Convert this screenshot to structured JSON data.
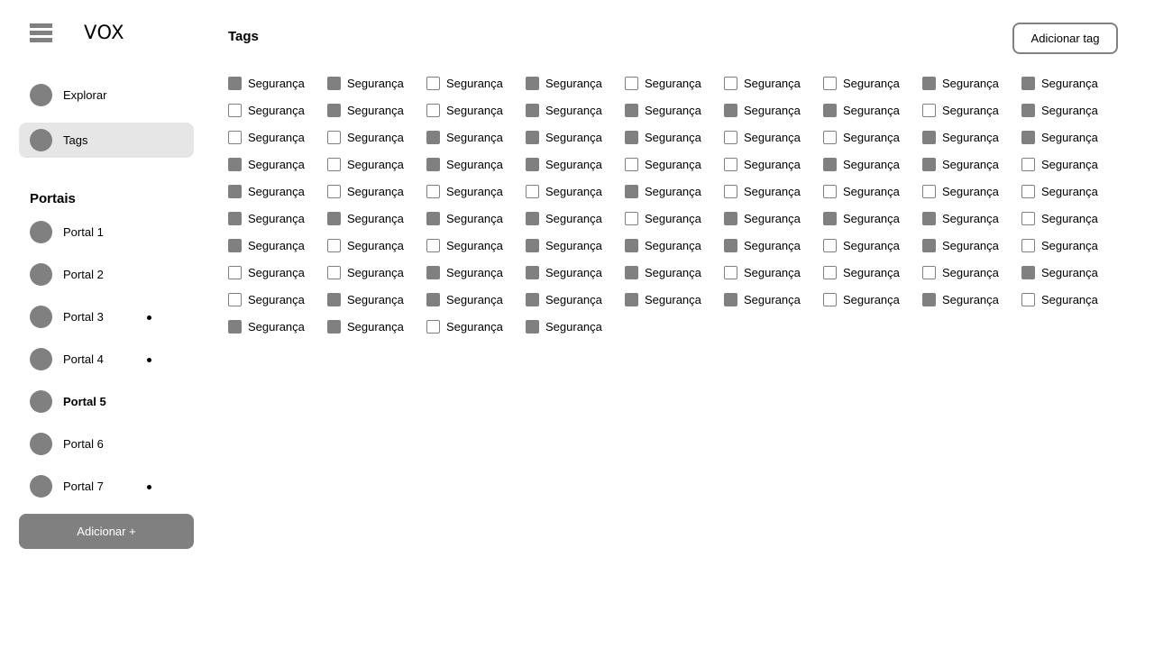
{
  "app": {
    "logo": "VOX"
  },
  "sidebar": {
    "nav": [
      {
        "label": "Explorar",
        "active": false
      },
      {
        "label": "Tags",
        "active": true
      }
    ],
    "portals_title": "Portais",
    "portals": [
      {
        "label": "Portal 1",
        "dot": false,
        "bold": false
      },
      {
        "label": "Portal 2",
        "dot": false,
        "bold": false
      },
      {
        "label": "Portal 3",
        "dot": true,
        "bold": false
      },
      {
        "label": "Portal 4",
        "dot": true,
        "bold": false
      },
      {
        "label": "Portal 5",
        "dot": false,
        "bold": true
      },
      {
        "label": "Portal 6",
        "dot": false,
        "bold": false
      },
      {
        "label": "Portal 7",
        "dot": true,
        "bold": false
      }
    ],
    "add_button": "Adicionar +"
  },
  "main": {
    "title": "Tags",
    "add_tag_button": "Adicionar tag",
    "tags": [
      {
        "label": "Segurança",
        "checked": true
      },
      {
        "label": "Segurança",
        "checked": true
      },
      {
        "label": "Segurança",
        "checked": false
      },
      {
        "label": "Segurança",
        "checked": true
      },
      {
        "label": "Segurança",
        "checked": false
      },
      {
        "label": "Segurança",
        "checked": false
      },
      {
        "label": "Segurança",
        "checked": false
      },
      {
        "label": "Segurança",
        "checked": true
      },
      {
        "label": "Segurança",
        "checked": true
      },
      {
        "label": "Segurança",
        "checked": false
      },
      {
        "label": "Segurança",
        "checked": true
      },
      {
        "label": "Segurança",
        "checked": false
      },
      {
        "label": "Segurança",
        "checked": true
      },
      {
        "label": "Segurança",
        "checked": true
      },
      {
        "label": "Segurança",
        "checked": true
      },
      {
        "label": "Segurança",
        "checked": true
      },
      {
        "label": "Segurança",
        "checked": false
      },
      {
        "label": "Segurança",
        "checked": true
      },
      {
        "label": "Segurança",
        "checked": false
      },
      {
        "label": "Segurança",
        "checked": false
      },
      {
        "label": "Segurança",
        "checked": true
      },
      {
        "label": "Segurança",
        "checked": true
      },
      {
        "label": "Segurança",
        "checked": true
      },
      {
        "label": "Segurança",
        "checked": false
      },
      {
        "label": "Segurança",
        "checked": false
      },
      {
        "label": "Segurança",
        "checked": true
      },
      {
        "label": "Segurança",
        "checked": true
      },
      {
        "label": "Segurança",
        "checked": true
      },
      {
        "label": "Segurança",
        "checked": false
      },
      {
        "label": "Segurança",
        "checked": true
      },
      {
        "label": "Segurança",
        "checked": true
      },
      {
        "label": "Segurança",
        "checked": false
      },
      {
        "label": "Segurança",
        "checked": false
      },
      {
        "label": "Segurança",
        "checked": true
      },
      {
        "label": "Segurança",
        "checked": true
      },
      {
        "label": "Segurança",
        "checked": false
      },
      {
        "label": "Segurança",
        "checked": true
      },
      {
        "label": "Segurança",
        "checked": false
      },
      {
        "label": "Segurança",
        "checked": false
      },
      {
        "label": "Segurança",
        "checked": false
      },
      {
        "label": "Segurança",
        "checked": true
      },
      {
        "label": "Segurança",
        "checked": false
      },
      {
        "label": "Segurança",
        "checked": false
      },
      {
        "label": "Segurança",
        "checked": false
      },
      {
        "label": "Segurança",
        "checked": false
      },
      {
        "label": "Segurança",
        "checked": true
      },
      {
        "label": "Segurança",
        "checked": true
      },
      {
        "label": "Segurança",
        "checked": true
      },
      {
        "label": "Segurança",
        "checked": true
      },
      {
        "label": "Segurança",
        "checked": false
      },
      {
        "label": "Segurança",
        "checked": true
      },
      {
        "label": "Segurança",
        "checked": true
      },
      {
        "label": "Segurança",
        "checked": true
      },
      {
        "label": "Segurança",
        "checked": false
      },
      {
        "label": "Segurança",
        "checked": true
      },
      {
        "label": "Segurança",
        "checked": false
      },
      {
        "label": "Segurança",
        "checked": false
      },
      {
        "label": "Segurança",
        "checked": true
      },
      {
        "label": "Segurança",
        "checked": true
      },
      {
        "label": "Segurança",
        "checked": true
      },
      {
        "label": "Segurança",
        "checked": false
      },
      {
        "label": "Segurança",
        "checked": true
      },
      {
        "label": "Segurança",
        "checked": false
      },
      {
        "label": "Segurança",
        "checked": false
      },
      {
        "label": "Segurança",
        "checked": false
      },
      {
        "label": "Segurança",
        "checked": true
      },
      {
        "label": "Segurança",
        "checked": true
      },
      {
        "label": "Segurança",
        "checked": true
      },
      {
        "label": "Segurança",
        "checked": false
      },
      {
        "label": "Segurança",
        "checked": false
      },
      {
        "label": "Segurança",
        "checked": false
      },
      {
        "label": "Segurança",
        "checked": true
      },
      {
        "label": "Segurança",
        "checked": false
      },
      {
        "label": "Segurança",
        "checked": true
      },
      {
        "label": "Segurança",
        "checked": true
      },
      {
        "label": "Segurança",
        "checked": true
      },
      {
        "label": "Segurança",
        "checked": true
      },
      {
        "label": "Segurança",
        "checked": true
      },
      {
        "label": "Segurança",
        "checked": false
      },
      {
        "label": "Segurança",
        "checked": true
      },
      {
        "label": "Segurança",
        "checked": false
      },
      {
        "label": "Segurança",
        "checked": true
      },
      {
        "label": "Segurança",
        "checked": true
      },
      {
        "label": "Segurança",
        "checked": false
      },
      {
        "label": "Segurança",
        "checked": true
      }
    ]
  }
}
